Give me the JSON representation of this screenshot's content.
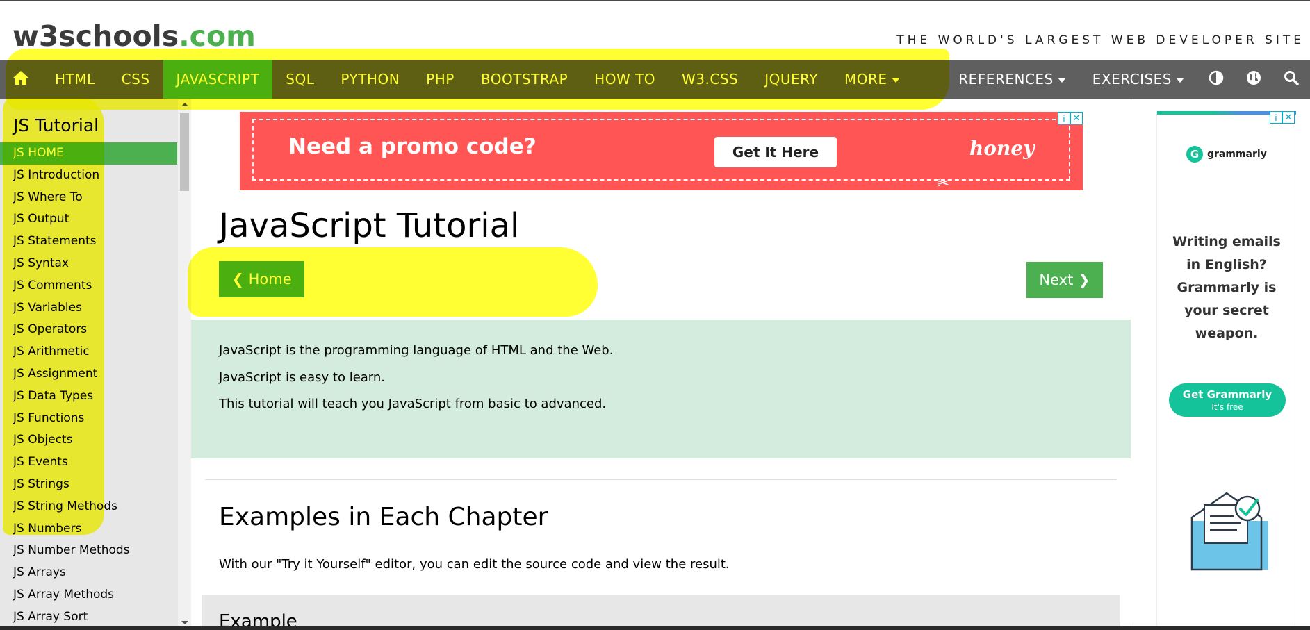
{
  "header": {
    "logo_main": "w3schools",
    "logo_tld": ".com",
    "tagline": "THE WORLD'S LARGEST WEB DEVELOPER SITE"
  },
  "nav": {
    "items": [
      "HTML",
      "CSS",
      "JAVASCRIPT",
      "SQL",
      "PYTHON",
      "PHP",
      "BOOTSTRAP",
      "HOW TO",
      "W3.CSS",
      "JQUERY",
      "MORE"
    ],
    "active": "JAVASCRIPT",
    "right_items": [
      "REFERENCES",
      "EXERCISES"
    ],
    "icons": [
      "home-icon",
      "contrast-icon",
      "globe-icon",
      "search-icon"
    ]
  },
  "sidebar": {
    "title": "JS Tutorial",
    "items": [
      "JS HOME",
      "JS Introduction",
      "JS Where To",
      "JS Output",
      "JS Statements",
      "JS Syntax",
      "JS Comments",
      "JS Variables",
      "JS Operators",
      "JS Arithmetic",
      "JS Assignment",
      "JS Data Types",
      "JS Functions",
      "JS Objects",
      "JS Events",
      "JS Strings",
      "JS String Methods",
      "JS Numbers",
      "JS Number Methods",
      "JS Arrays",
      "JS Array Methods",
      "JS Array Sort"
    ],
    "active": "JS HOME"
  },
  "ad_banner": {
    "headline": "Need a promo code?",
    "button": "Get It Here",
    "brand": "honey"
  },
  "main": {
    "title": "JavaScript Tutorial",
    "home_button": "❮ Home",
    "next_button": "Next ❯",
    "intro": [
      "JavaScript is the programming language of HTML and the Web.",
      "JavaScript is easy to learn.",
      "This tutorial will teach you JavaScript from basic to advanced."
    ],
    "section_title": "Examples in Each Chapter",
    "section_text": "With our \"Try it Yourself\" editor, you can edit the source code and view the result.",
    "example_heading": "Example"
  },
  "side_ad": {
    "brand": "grammarly",
    "message_lines": [
      "Writing emails",
      "in English?",
      "Grammarly is",
      "your secret",
      "weapon."
    ],
    "cta": "Get Grammarly",
    "cta_sub": "It's free"
  },
  "colors": {
    "nav_bg": "#5f5f5f",
    "accent_green": "#4caf50",
    "intro_bg": "#d4ecdd",
    "sidebar_bg": "#e7e7e7",
    "promo_red": "#ff5555",
    "grammarly_green": "#15c39a",
    "highlighter": "#ffff00"
  }
}
